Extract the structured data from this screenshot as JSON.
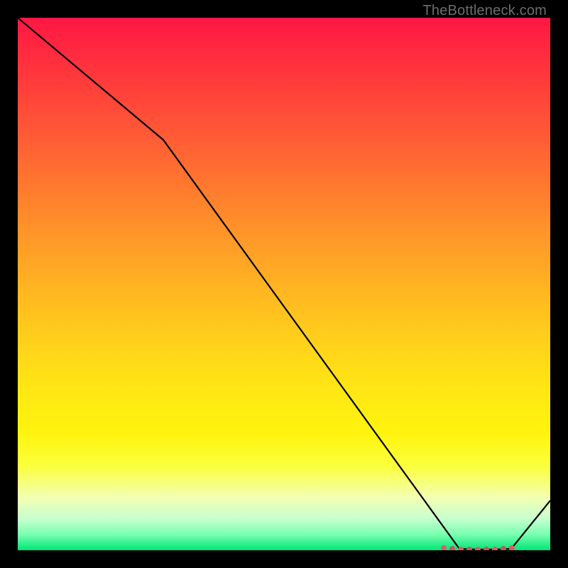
{
  "attribution": "TheBottleneck.com",
  "chart_data": {
    "type": "line",
    "title": "",
    "xlabel": "",
    "ylabel": "",
    "xlim": [
      0,
      100
    ],
    "ylim": [
      0,
      100
    ],
    "x": [
      0,
      27,
      83,
      90,
      100
    ],
    "values": [
      100,
      77,
      0,
      0,
      10
    ],
    "minimum_band": {
      "x_start": 82,
      "x_end": 92,
      "y": 0
    },
    "gradient_stops": [
      {
        "pct": 0,
        "color": "#ff1744"
      },
      {
        "pct": 50,
        "color": "#ffb820"
      },
      {
        "pct": 80,
        "color": "#fff40e"
      },
      {
        "pct": 100,
        "color": "#00e676"
      }
    ]
  }
}
